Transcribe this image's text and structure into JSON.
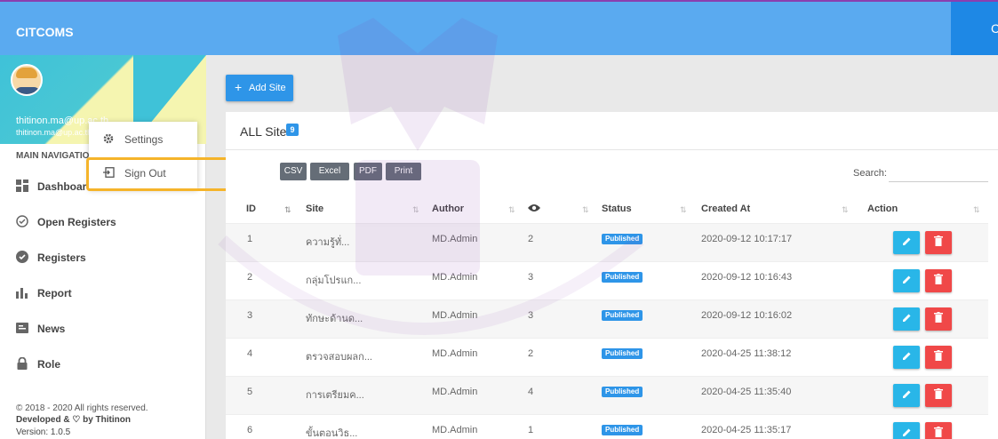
{
  "app": {
    "brand": "CITCOMS",
    "header_right_glyph": "C"
  },
  "user": {
    "email": "thitinon.ma@up.ac.th",
    "email_small": "thitinon.ma@up.ac.th"
  },
  "user_menu": {
    "settings_label": "Settings",
    "sign_out_label": "Sign Out"
  },
  "sidebar": {
    "header": "MAIN NAVIGATION",
    "items": [
      {
        "label": "Dashboard",
        "icon": "dashboard-icon"
      },
      {
        "label": "Open Registers",
        "icon": "add-check-icon"
      },
      {
        "label": "Registers",
        "icon": "check-circle-icon"
      },
      {
        "label": "Report",
        "icon": "bar-chart-icon"
      },
      {
        "label": "News",
        "icon": "news-icon"
      },
      {
        "label": "Role",
        "icon": "lock-icon"
      }
    ],
    "footer_copyright": "© 2018 - 2020 All rights reserved.",
    "footer_developed": "Developed & ♡ by Thitinon",
    "footer_version": "Version: 1.0.5"
  },
  "main": {
    "add_button": "Add Site",
    "card_title": "ALL Site",
    "card_count": "9",
    "export_buttons": [
      "CSV",
      "Excel",
      "PDF",
      "Print"
    ],
    "search_label": "Search:",
    "search_value": ""
  },
  "table": {
    "columns": [
      "ID",
      "Site",
      "Author",
      "",
      "Status",
      "Created At",
      "Action"
    ],
    "rows": [
      {
        "id": "1",
        "site": "ความรู้ทั่...",
        "author": "MD.Admin",
        "views": "2",
        "status": "Published",
        "created": "2020-09-12 10:17:17"
      },
      {
        "id": "2",
        "site": "กลุ่มโปรแก...",
        "author": "MD.Admin",
        "views": "3",
        "status": "Published",
        "created": "2020-09-12 10:16:43"
      },
      {
        "id": "3",
        "site": "ทักษะด้านด...",
        "author": "MD.Admin",
        "views": "3",
        "status": "Published",
        "created": "2020-09-12 10:16:02"
      },
      {
        "id": "4",
        "site": "ตรวจสอบผลก...",
        "author": "MD.Admin",
        "views": "2",
        "status": "Published",
        "created": "2020-04-25 11:38:12"
      },
      {
        "id": "5",
        "site": "การเตรียมค...",
        "author": "MD.Admin",
        "views": "4",
        "status": "Published",
        "created": "2020-04-25 11:35:40"
      },
      {
        "id": "6",
        "site": "ขั้นตอนวิธ...",
        "author": "MD.Admin",
        "views": "1",
        "status": "Published",
        "created": "2020-04-25 11:35:17"
      }
    ]
  },
  "colors": {
    "topbar": "#5aaaf0",
    "accent": "#2e95e8",
    "highlight": "#f5b42a",
    "delete": "#f04848",
    "edit": "#29b6e8"
  }
}
